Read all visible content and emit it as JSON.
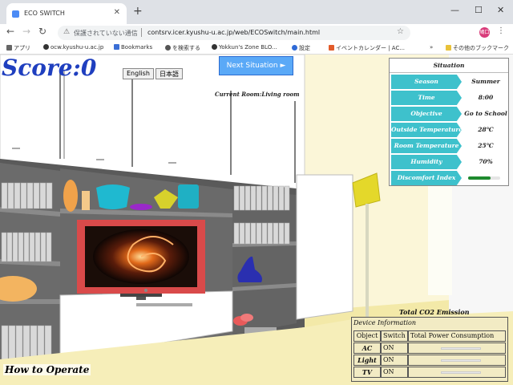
{
  "browser": {
    "tab_title": "ECO SWITCH",
    "tab_close": "✕",
    "new_tab": "+",
    "win_min": "—",
    "win_max": "☐",
    "win_close": "✕",
    "security_text": "保護されていない通信",
    "url": "contsrv.icer.kyushu-u.ac.jp/web/ECOSwitch/main.html",
    "profile_label": "鳩口",
    "bookmarks": [
      "アプリ",
      "ocw.kyushu-u.ac.jp",
      "Bookmarks",
      "を検索する",
      "Yokkun's Zone BLO...",
      "設定",
      "イベントカレンダー | AC...",
      "その他のブックマーク"
    ],
    "bookmarks_more": "»"
  },
  "game": {
    "score_label": "Score:0",
    "lang_english": "English",
    "lang_japanese": "日本語",
    "next_button": "Next Situation ►",
    "current_room": "Current Room:Living room",
    "how_to": "How to Operate",
    "co2_title": "Total CO2 Emission"
  },
  "situation": {
    "title": "Situation",
    "rows": [
      {
        "label": "Season",
        "value": "Summer"
      },
      {
        "label": "Time",
        "value": "8:00"
      },
      {
        "label": "Objective",
        "value": "Go to School"
      },
      {
        "label": "Outside Temperature",
        "value": "28℃"
      },
      {
        "label": "Room Temperature",
        "value": "25℃"
      },
      {
        "label": "Humidity",
        "value": "70%"
      },
      {
        "label": "Discomfort Index",
        "value": ""
      }
    ],
    "discomfort_level": 0.7,
    "discomfort_color": "#1e8a2e"
  },
  "device_info": {
    "title": "Device Information",
    "headers": [
      "Object",
      "Switch",
      "Total Power Consumption"
    ],
    "rows": [
      {
        "object": "AC",
        "switch": "ON"
      },
      {
        "object": "Light",
        "switch": "ON"
      },
      {
        "object": "TV",
        "switch": "ON"
      }
    ]
  },
  "colors": {
    "score": "#1f3fbf",
    "label_bg": "#3ec1cc",
    "next_button": "#5aa9f7",
    "tv_frame": "#d94a4a",
    "panel_bg": "#f2ebc4"
  }
}
